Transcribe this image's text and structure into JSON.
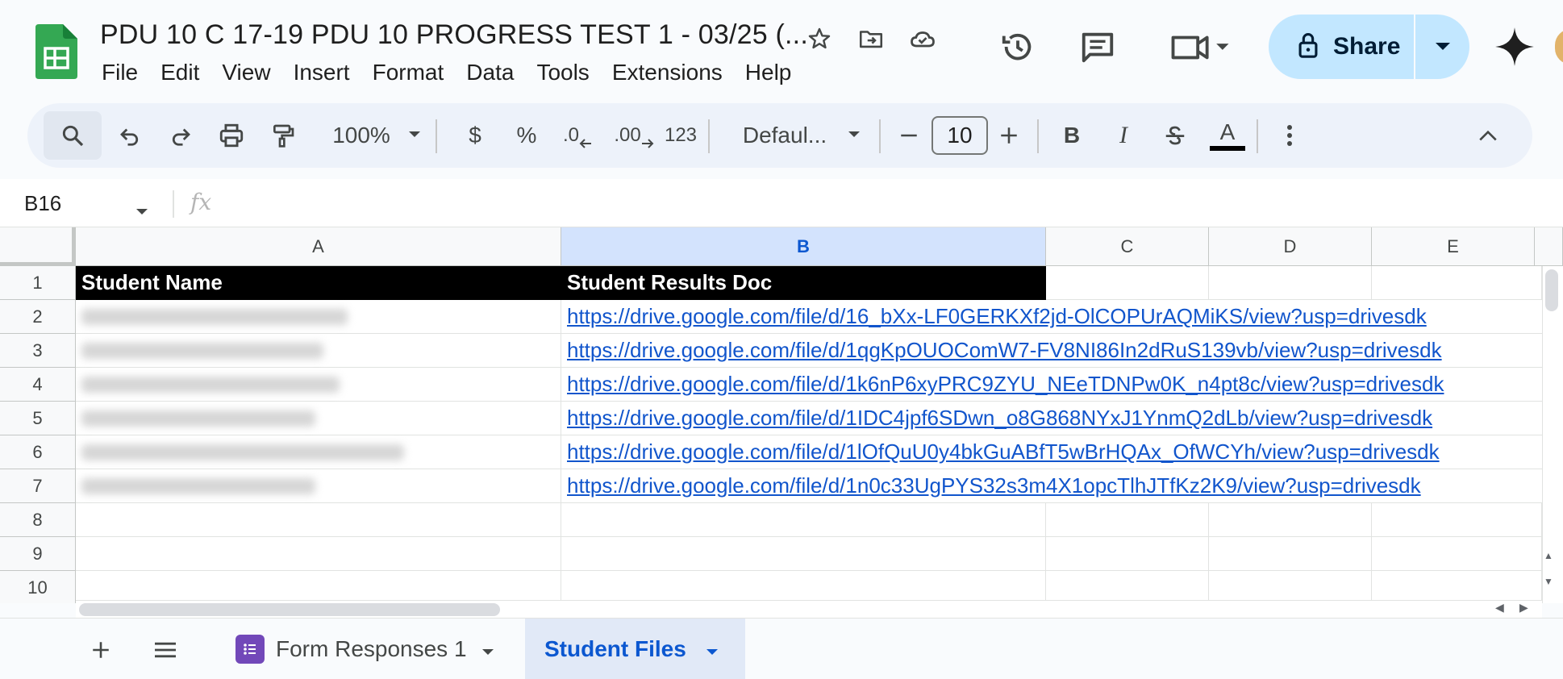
{
  "document": {
    "title": "PDU 10 C 17-19 PDU 10 PROGRESS TEST 1 - 03/25 (..."
  },
  "menu": [
    "File",
    "Edit",
    "View",
    "Insert",
    "Format",
    "Data",
    "Tools",
    "Extensions",
    "Help"
  ],
  "header": {
    "share_label": "Share",
    "icons": [
      "star-icon",
      "move-to-folder-icon",
      "cloud-saved-icon",
      "version-history-icon",
      "comments-icon",
      "meet-icon",
      "lock-icon",
      "gemini-icon"
    ]
  },
  "toolbar": {
    "zoom": "100%",
    "currency": "$",
    "percent": "%",
    "decrease_decimal": ".0",
    "increase_decimal": ".00",
    "number_format": "123",
    "font": "Defaul...",
    "font_size": "10",
    "bold": "B",
    "italic": "I",
    "text_color_glyph": "A"
  },
  "formula_bar": {
    "name_box": "B16",
    "fx": "fx",
    "value": ""
  },
  "grid": {
    "columns": [
      "A",
      "B",
      "C",
      "D",
      "E"
    ],
    "selected_column": "B",
    "rows": [
      "1",
      "2",
      "3",
      "4",
      "5",
      "6",
      "7",
      "8",
      "9",
      "10"
    ],
    "header_row": {
      "A": "Student Name",
      "B": "Student Results Doc"
    },
    "data_rows": [
      {
        "name_redacted": true,
        "link": "https://drive.google.com/file/d/16_bXx-LF0GERKXf2jd-OlCOPUrAQMiKS/view?usp=drivesdk"
      },
      {
        "name_redacted": true,
        "link": "https://drive.google.com/file/d/1qgKpOUOComW7-FV8NI86In2dRuS139vb/view?usp=drivesdk"
      },
      {
        "name_redacted": true,
        "link": "https://drive.google.com/file/d/1k6nP6xyPRC9ZYU_NEeTDNPw0K_n4pt8c/view?usp=drivesdk"
      },
      {
        "name_redacted": true,
        "link": "https://drive.google.com/file/d/1IDC4jpf6SDwn_o8G868NYxJ1YnmQ2dLb/view?usp=drivesdk"
      },
      {
        "name_redacted": true,
        "link": "https://drive.google.com/file/d/1lOfQuU0y4bkGuABfT5wBrHQAx_OfWCYh/view?usp=drivesdk"
      },
      {
        "name_redacted": true,
        "link": "https://drive.google.com/file/d/1n0c33UgPYS32s3m4X1opcTlhJTfKz2K9/view?usp=drivesdk"
      }
    ]
  },
  "sheets": {
    "tabs": [
      {
        "label": "Form Responses 1",
        "active": false
      },
      {
        "label": "Student Files",
        "active": true
      }
    ]
  },
  "colors": {
    "share_bg": "#c2e7ff",
    "selected_col_bg": "#d3e3fd",
    "link": "#1155cc",
    "header_row_bg": "#000000",
    "active_tab": "#0b57d0"
  }
}
